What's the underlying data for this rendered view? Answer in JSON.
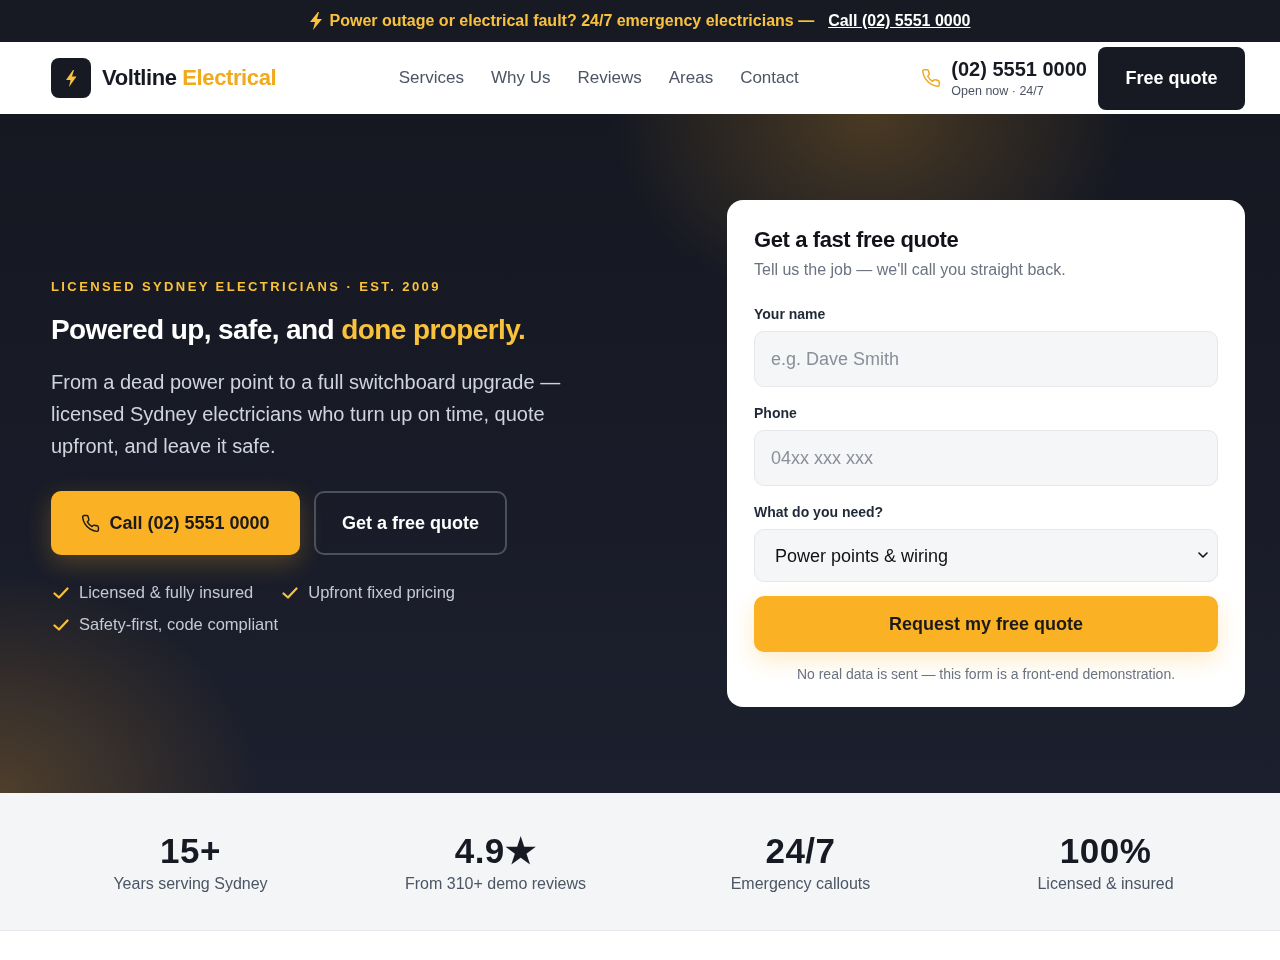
{
  "alert_bar": {
    "message": "Power outage or electrical fault? 24/7 emergency electricians —",
    "link": "Call (02) 5551 0000"
  },
  "header": {
    "brand": {
      "name": "Voltline",
      "accent": "Electrical"
    },
    "nav": [
      "Services",
      "Why Us",
      "Reviews",
      "Areas",
      "Contact"
    ],
    "phone": {
      "number": "(02) 5551 0000",
      "status": "Open now · 24/7"
    },
    "cta": "Free quote"
  },
  "hero": {
    "eyebrow": "LICENSED SYDNEY ELECTRICIANS · EST. 2009",
    "heading": {
      "text": "Powered up, safe, and",
      "highlight": "done properly."
    },
    "intro": "From a dead power point to a full switchboard upgrade — licensed Sydney electricians who turn up on time, quote upfront, and leave it safe.",
    "buttons": [
      {
        "label": "Call (02) 5551 0000",
        "kind": "primary"
      },
      {
        "label": "Get a free quote",
        "kind": "outline"
      }
    ],
    "features": [
      "Licensed & fully insured",
      "Upfront fixed pricing",
      "Safety-first, code compliant"
    ]
  },
  "quote_form": {
    "title": "Get a fast free quote",
    "subtitle": "Tell us the job — we'll call you straight back.",
    "fields": [
      {
        "label": "Your name",
        "kind": "text",
        "placeholder": "e.g. Dave Smith"
      },
      {
        "label": "Phone",
        "kind": "text",
        "placeholder": "04xx xxx xxx"
      },
      {
        "label": "What do you need?",
        "kind": "select",
        "value": "Power points & wiring"
      }
    ],
    "submit": "Request my free quote",
    "note": "No real data is sent — this form is a front-end demonstration."
  },
  "stats": [
    {
      "value": "15+",
      "label": "Years serving Sydney"
    },
    {
      "value": "4.9★",
      "label": "From 310+ demo reviews"
    },
    {
      "value": "24/7",
      "label": "Emergency callouts"
    },
    {
      "value": "100%",
      "label": "Licensed & insured"
    }
  ]
}
